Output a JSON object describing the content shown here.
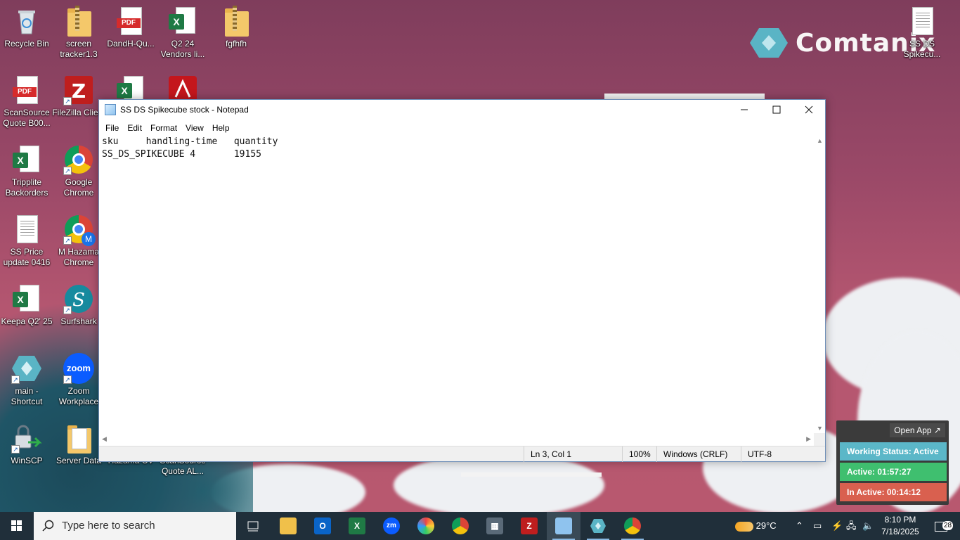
{
  "desktop": {
    "brand": "Comtanix",
    "icons": [
      {
        "label": "Recycle Bin"
      },
      {
        "label": "screen tracker1.3"
      },
      {
        "label": "DandH-Qu..."
      },
      {
        "label": "Q2 24 Vendors li..."
      },
      {
        "label": "fgfhfh"
      },
      {
        "label": "ScanSource Quote B00..."
      },
      {
        "label": "FileZilla Client"
      },
      {
        "label": "Tripplite Backorders"
      },
      {
        "label": "Google Chrome"
      },
      {
        "label": "SS Price update 0416"
      },
      {
        "label": "M Hazama Chrome"
      },
      {
        "label": "Keepa Q2' 25"
      },
      {
        "label": "Surfshark"
      },
      {
        "label": "main - Shortcut"
      },
      {
        "label": "Zoom Workplace"
      },
      {
        "label": "WinSCP"
      },
      {
        "label": "Server Data"
      },
      {
        "label": "Hazama CV"
      },
      {
        "label": "ScanSource Quote AL..."
      },
      {
        "label": "SS DS Spikecu..."
      }
    ],
    "pdf_badge": "PDF",
    "xl_badge": "X",
    "zoom_text": "zoom"
  },
  "notepad": {
    "title": "SS DS Spikecube stock  - Notepad",
    "menu": [
      "File",
      "Edit",
      "Format",
      "View",
      "Help"
    ],
    "content": {
      "line1": "sku     handling-time   quantity",
      "line2": "SS_DS_SPIKECUBE 4       19155"
    },
    "status": {
      "position": "Ln 3, Col 1",
      "zoom": "100%",
      "line_ending": "Windows (CRLF)",
      "encoding": "UTF-8"
    }
  },
  "tracker": {
    "open_app": "Open App ↗",
    "working_status": "Working Status: Active",
    "active": "Active: 01:57:27",
    "inactive": "In Active: 00:14:12",
    "colors": {
      "status": "#5bb7c8",
      "active": "#3fbf6f",
      "inactive": "#d9604f"
    }
  },
  "taskbar": {
    "search_placeholder": "Type here to search",
    "weather": "29°C",
    "time": "8:10 PM",
    "date": "7/18/2025",
    "notifications": "28",
    "apps": [
      "file-explorer",
      "outlook",
      "excel",
      "zoom",
      "paint",
      "chrome-profile",
      "calculator",
      "filezilla",
      "notepad",
      "comtanix",
      "chrome"
    ]
  }
}
